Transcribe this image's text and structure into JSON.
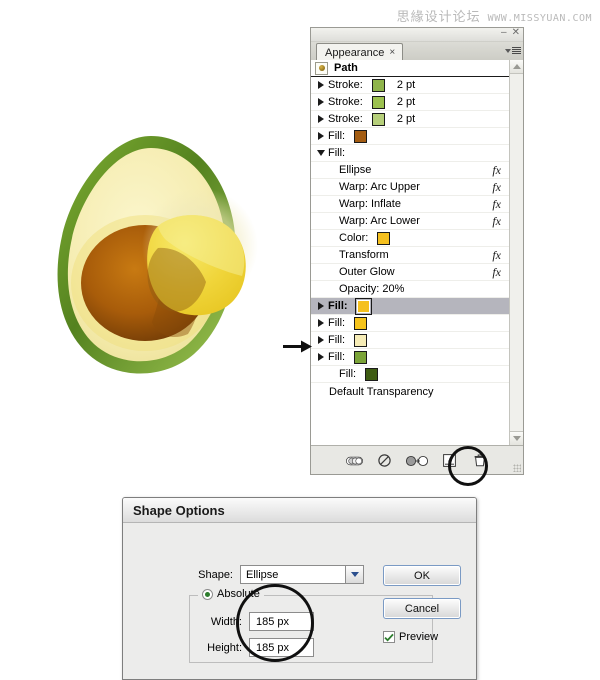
{
  "watermark": {
    "cn_text": "思緣设计论坛",
    "url_text": "WWW.MISSYUAN.COM"
  },
  "artwork": {
    "name": "avocado-half-illustration",
    "skin_dark": "#4e7a22",
    "skin_light": "#9dc24b",
    "flesh": "#f5ecb0",
    "pit": "#a85c0a",
    "ellipse_overlay": "#f2d93a"
  },
  "panel": {
    "title_tab": "Appearance",
    "tab_close": "×",
    "minimize": "–",
    "close": "✕",
    "header": {
      "label": "Path",
      "icon": "target-path-icon"
    },
    "rows": [
      {
        "id": "stroke-1",
        "disclosure": "right",
        "label": "Stroke:",
        "swatch": "#8fb44a",
        "value": "2 pt",
        "fx": false,
        "selected": false,
        "indent": false
      },
      {
        "id": "stroke-2",
        "disclosure": "right",
        "label": "Stroke:",
        "swatch": "#9cc14f",
        "value": "2 pt",
        "fx": false,
        "selected": false,
        "indent": false
      },
      {
        "id": "stroke-3",
        "disclosure": "right",
        "label": "Stroke:",
        "swatch": "#b6cf7a",
        "value": "2 pt",
        "fx": false,
        "selected": false,
        "indent": false
      },
      {
        "id": "fill-brown",
        "disclosure": "right",
        "label": "Fill:",
        "swatch": "#a35c12",
        "value": "",
        "fx": false,
        "selected": false,
        "indent": false
      },
      {
        "id": "fill-open",
        "disclosure": "down",
        "label": "Fill:",
        "swatch": null,
        "value": "",
        "fx": false,
        "selected": false,
        "indent": false
      },
      {
        "id": "fx-ellipse",
        "disclosure": "none",
        "label": "Ellipse",
        "swatch": null,
        "value": "",
        "fx": true,
        "selected": false,
        "indent": true
      },
      {
        "id": "fx-warp-arc-up",
        "disclosure": "none",
        "label": "Warp: Arc Upper",
        "swatch": null,
        "value": "",
        "fx": true,
        "selected": false,
        "indent": true
      },
      {
        "id": "fx-warp-inflate",
        "disclosure": "none",
        "label": "Warp: Inflate",
        "swatch": null,
        "value": "",
        "fx": true,
        "selected": false,
        "indent": true
      },
      {
        "id": "fx-warp-arc-low",
        "disclosure": "none",
        "label": "Warp: Arc Lower",
        "swatch": null,
        "value": "",
        "fx": true,
        "selected": false,
        "indent": true
      },
      {
        "id": "fx-color",
        "disclosure": "none",
        "label": "Color:",
        "swatch": "#f5c01e",
        "value": "",
        "fx": false,
        "selected": false,
        "indent": true
      },
      {
        "id": "fx-transform",
        "disclosure": "none",
        "label": "Transform",
        "swatch": null,
        "value": "",
        "fx": true,
        "selected": false,
        "indent": true
      },
      {
        "id": "fx-outer-glow",
        "disclosure": "none",
        "label": "Outer Glow",
        "swatch": null,
        "value": "",
        "fx": true,
        "selected": false,
        "indent": true
      },
      {
        "id": "fx-opacity",
        "disclosure": "none",
        "label": "Opacity: 20%",
        "swatch": null,
        "value": "",
        "fx": false,
        "selected": false,
        "indent": true
      },
      {
        "id": "fill-sel",
        "disclosure": "right",
        "label": "Fill:",
        "swatch": "#f5c01e",
        "value": "",
        "fx": false,
        "selected": true,
        "indent": false
      },
      {
        "id": "fill-yellow",
        "disclosure": "right",
        "label": "Fill:",
        "swatch": "#f6c41c",
        "value": "",
        "fx": false,
        "selected": false,
        "indent": false
      },
      {
        "id": "fill-cream",
        "disclosure": "right",
        "label": "Fill:",
        "swatch": "#f6ecb6",
        "value": "",
        "fx": false,
        "selected": false,
        "indent": false
      },
      {
        "id": "fill-green",
        "disclosure": "right",
        "label": "Fill:",
        "swatch": "#7ba438",
        "value": "",
        "fx": false,
        "selected": false,
        "indent": false
      },
      {
        "id": "fill-darkgreen",
        "disclosure": "none",
        "label": "Fill:",
        "swatch": "#3e5c12",
        "value": "",
        "fx": false,
        "selected": false,
        "indent": true
      }
    ],
    "footer_label": "Default Transparency",
    "buttons": [
      {
        "id": "opacity-button",
        "name": "opacity-appearance-icon"
      },
      {
        "id": "clear-appearance-button",
        "name": "clear-appearance-icon"
      },
      {
        "id": "reduce-to-basic-button",
        "name": "reduce-to-basic-appearance-icon"
      },
      {
        "id": "duplicate-item-button",
        "name": "duplicate-selected-item-icon"
      },
      {
        "id": "delete-item-button",
        "name": "trash-icon"
      }
    ]
  },
  "annotation": {
    "arrow_name": "pointer-arrow",
    "circle_panel_button": "duplicate-selected-item-highlight",
    "circle_dialog_fields": "width-height-fields-highlight"
  },
  "dialog": {
    "title": "Shape Options",
    "shape_label": "Shape:",
    "shape_value": "Ellipse",
    "absolute_label": "Absolute",
    "width_label": "Width:",
    "width_value": "185 px",
    "height_label": "Height:",
    "height_value": "185 px",
    "ok_label": "OK",
    "cancel_label": "Cancel",
    "preview_label": "Preview",
    "preview_checked": true
  }
}
